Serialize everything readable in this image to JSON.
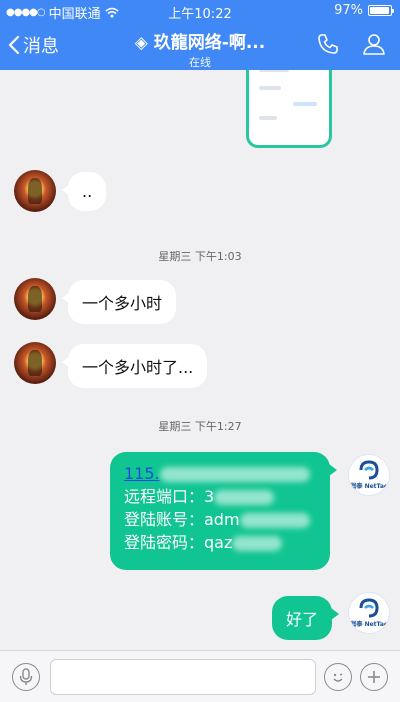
{
  "statusbar": {
    "carrier": "中国联通",
    "time": "上午10:22",
    "battery": "97%",
    "battery_level": 0.97
  },
  "nav": {
    "back_label": "消息",
    "title": "◈ 玖龍网络-啊...",
    "subtitle": "在线"
  },
  "messages": [
    {
      "side": "left",
      "text": ".."
    },
    {
      "type": "time",
      "text": "星期三 下午1:03"
    },
    {
      "side": "left",
      "text": "一个多小时"
    },
    {
      "side": "left",
      "text": "一个多小时了..."
    },
    {
      "type": "time",
      "text": "星期三 下午1:27"
    },
    {
      "side": "right",
      "lines": [
        "115.",
        "远程端口：3",
        "登陆账号：adm",
        "登陆密码：qaz"
      ]
    },
    {
      "side": "right",
      "text": "好了"
    }
  ],
  "avatar_right_logo": "润泰 NetTac",
  "inputbar": {
    "placeholder": ""
  },
  "colors": {
    "header": "#3f88f5",
    "bubble_sent": "#11c592",
    "bubble_received": "#ffffff",
    "background": "#f0f0f3"
  },
  "icons": [
    "back-chevron-icon",
    "phone-icon",
    "contact-icon",
    "microphone-icon",
    "emoji-icon",
    "plus-icon",
    "wifi-icon"
  ]
}
